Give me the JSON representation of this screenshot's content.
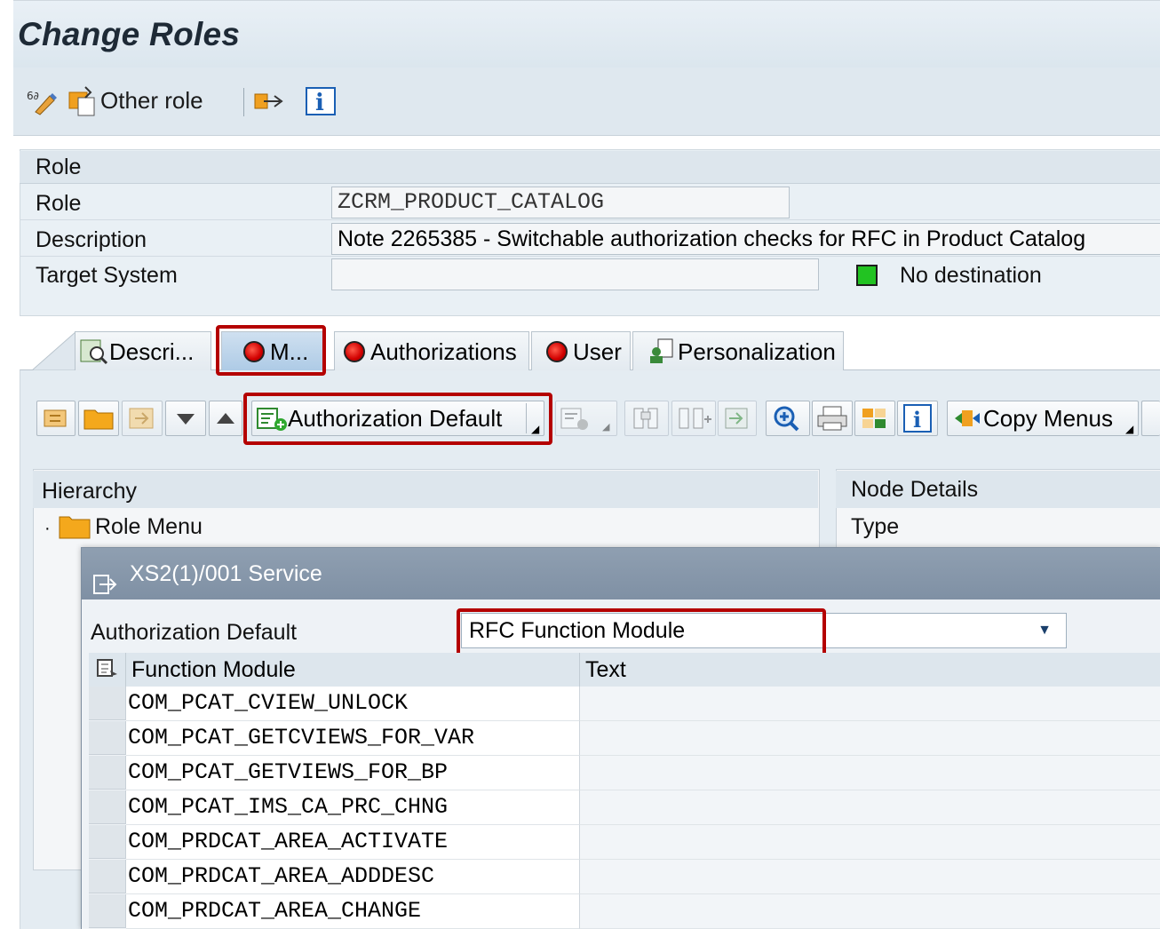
{
  "window": {
    "title": "Change Roles"
  },
  "toolbar": {
    "other_role_label": "Other role"
  },
  "role_section": {
    "header": "Role",
    "role_label": "Role",
    "role_value": "ZCRM_PRODUCT_CATALOG",
    "description_label": "Description",
    "description_value": "Note 2265385 - Switchable authorization checks for RFC in Product Catalog",
    "target_system_label": "Target System",
    "target_system_value": "",
    "destination_status": "No destination",
    "status_color": "#22c322"
  },
  "tabs": [
    {
      "label": "Descri..."
    },
    {
      "label": "M..."
    },
    {
      "label": "Authorizations"
    },
    {
      "label": "User"
    },
    {
      "label": "Personalization"
    }
  ],
  "menu_toolbar": {
    "authorization_default_label": "Authorization Default",
    "copy_menus_label": "Copy Menus"
  },
  "hierarchy": {
    "header": "Hierarchy",
    "root_item": "Role Menu"
  },
  "node_details": {
    "header": "Node Details",
    "type_label": "Type"
  },
  "dialog": {
    "title": "XS2(1)/001 Service",
    "auth_default_label": "Authorization Default",
    "auth_default_value": "RFC Function Module",
    "columns": [
      "Function Module",
      "Text"
    ],
    "rows": [
      {
        "module": "COM_PCAT_CVIEW_UNLOCK",
        "text": ""
      },
      {
        "module": "COM_PCAT_GETCVIEWS_FOR_VAR",
        "text": ""
      },
      {
        "module": "COM_PCAT_GETVIEWS_FOR_BP",
        "text": ""
      },
      {
        "module": "COM_PCAT_IMS_CA_PRC_CHNG",
        "text": ""
      },
      {
        "module": "COM_PRDCAT_AREA_ACTIVATE",
        "text": ""
      },
      {
        "module": "COM_PRDCAT_AREA_ADDDESC",
        "text": ""
      },
      {
        "module": "COM_PRDCAT_AREA_CHANGE",
        "text": ""
      }
    ]
  },
  "highlight_color": "#b40000"
}
